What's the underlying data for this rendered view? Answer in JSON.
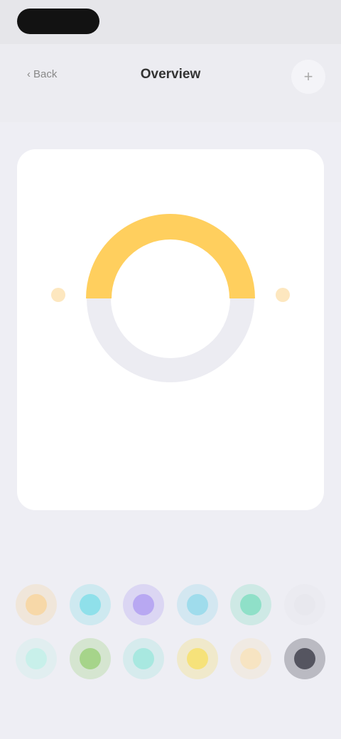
{
  "status": {
    "time": "",
    "right": ""
  },
  "nav": {
    "back_label": "Back",
    "title": "Overview",
    "action_icon": "plus-icon"
  },
  "card": {
    "title": "",
    "subtitle": "",
    "gauge": {
      "fraction": 0.5,
      "fill_color": "#ffcf5e",
      "track_color": "#ececf2"
    },
    "left_label": "",
    "right_label": "",
    "center_value": "",
    "center_caption": "",
    "stats": [
      {
        "label": "",
        "value": ""
      },
      {
        "label": "",
        "value": ""
      },
      {
        "label": "",
        "value": ""
      },
      {
        "label": "",
        "value": ""
      }
    ]
  },
  "palette": {
    "row1": [
      "#f7d8a8",
      "#8fe0ea",
      "#b8a8f2",
      "#9fdcec",
      "#8fe0c8",
      "#e8e8ee"
    ],
    "row2": [
      "#c8f0ea",
      "#a6d48a",
      "#a8e8e0",
      "#f6e27a",
      "#f7e4c2",
      "#555560"
    ]
  }
}
